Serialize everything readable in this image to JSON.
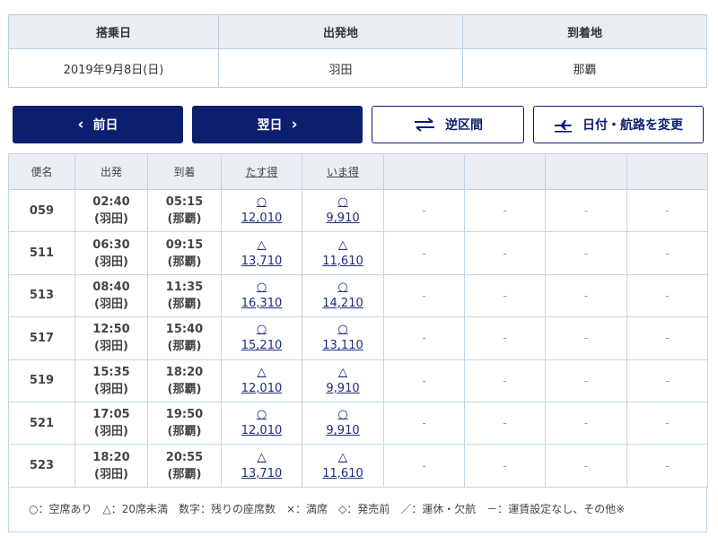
{
  "summary": {
    "headers": [
      "搭乗日",
      "出発地",
      "到着地"
    ],
    "values": [
      "2019年9月8日(日)",
      "羽田",
      "那覇"
    ]
  },
  "buttons": {
    "prev_label": "前日",
    "next_label": "翌日",
    "reverse_label": "逆区間",
    "change_label": "日付・航路を変更"
  },
  "table": {
    "headers": [
      "便名",
      "出発",
      "到着",
      "たす得",
      "いま得",
      "",
      "",
      "",
      ""
    ],
    "rows": [
      {
        "flight": "059",
        "dep_time": "02:40",
        "dep_place": "(羽田)",
        "arr_time": "05:15",
        "arr_place": "(那覇)",
        "f1_mark": "○",
        "f1_price": "12,010",
        "f2_mark": "○",
        "f2_price": "9,910"
      },
      {
        "flight": "511",
        "dep_time": "06:30",
        "dep_place": "(羽田)",
        "arr_time": "09:15",
        "arr_place": "(那覇)",
        "f1_mark": "△",
        "f1_price": "13,710",
        "f2_mark": "△",
        "f2_price": "11,610"
      },
      {
        "flight": "513",
        "dep_time": "08:40",
        "dep_place": "(羽田)",
        "arr_time": "11:35",
        "arr_place": "(那覇)",
        "f1_mark": "○",
        "f1_price": "16,310",
        "f2_mark": "○",
        "f2_price": "14,210"
      },
      {
        "flight": "517",
        "dep_time": "12:50",
        "dep_place": "(羽田)",
        "arr_time": "15:40",
        "arr_place": "(那覇)",
        "f1_mark": "○",
        "f1_price": "15,210",
        "f2_mark": "○",
        "f2_price": "13,110"
      },
      {
        "flight": "519",
        "dep_time": "15:35",
        "dep_place": "(羽田)",
        "arr_time": "18:20",
        "arr_place": "(那覇)",
        "f1_mark": "△",
        "f1_price": "12,010",
        "f2_mark": "△",
        "f2_price": "9,910"
      },
      {
        "flight": "521",
        "dep_time": "17:05",
        "dep_place": "(羽田)",
        "arr_time": "19:50",
        "arr_place": "(那覇)",
        "f1_mark": "○",
        "f1_price": "12,010",
        "f2_mark": "○",
        "f2_price": "9,910"
      },
      {
        "flight": "523",
        "dep_time": "18:20",
        "dep_place": "(羽田)",
        "arr_time": "20:55",
        "arr_place": "(那覇)",
        "f1_mark": "△",
        "f1_price": "13,710",
        "f2_mark": "△",
        "f2_price": "11,610"
      }
    ],
    "empty_cell": "-"
  },
  "legend": "○：空席あり　△：20席未満　数字：残りの座席数　×：満席　◇：発売前　／：運休・欠航　－：運賃設定なし、その他※",
  "colors": {
    "primary": "#0b1f6e",
    "header_bg": "#eaeef3",
    "border": "#c3d4e3",
    "link": "#1b2d7c"
  }
}
